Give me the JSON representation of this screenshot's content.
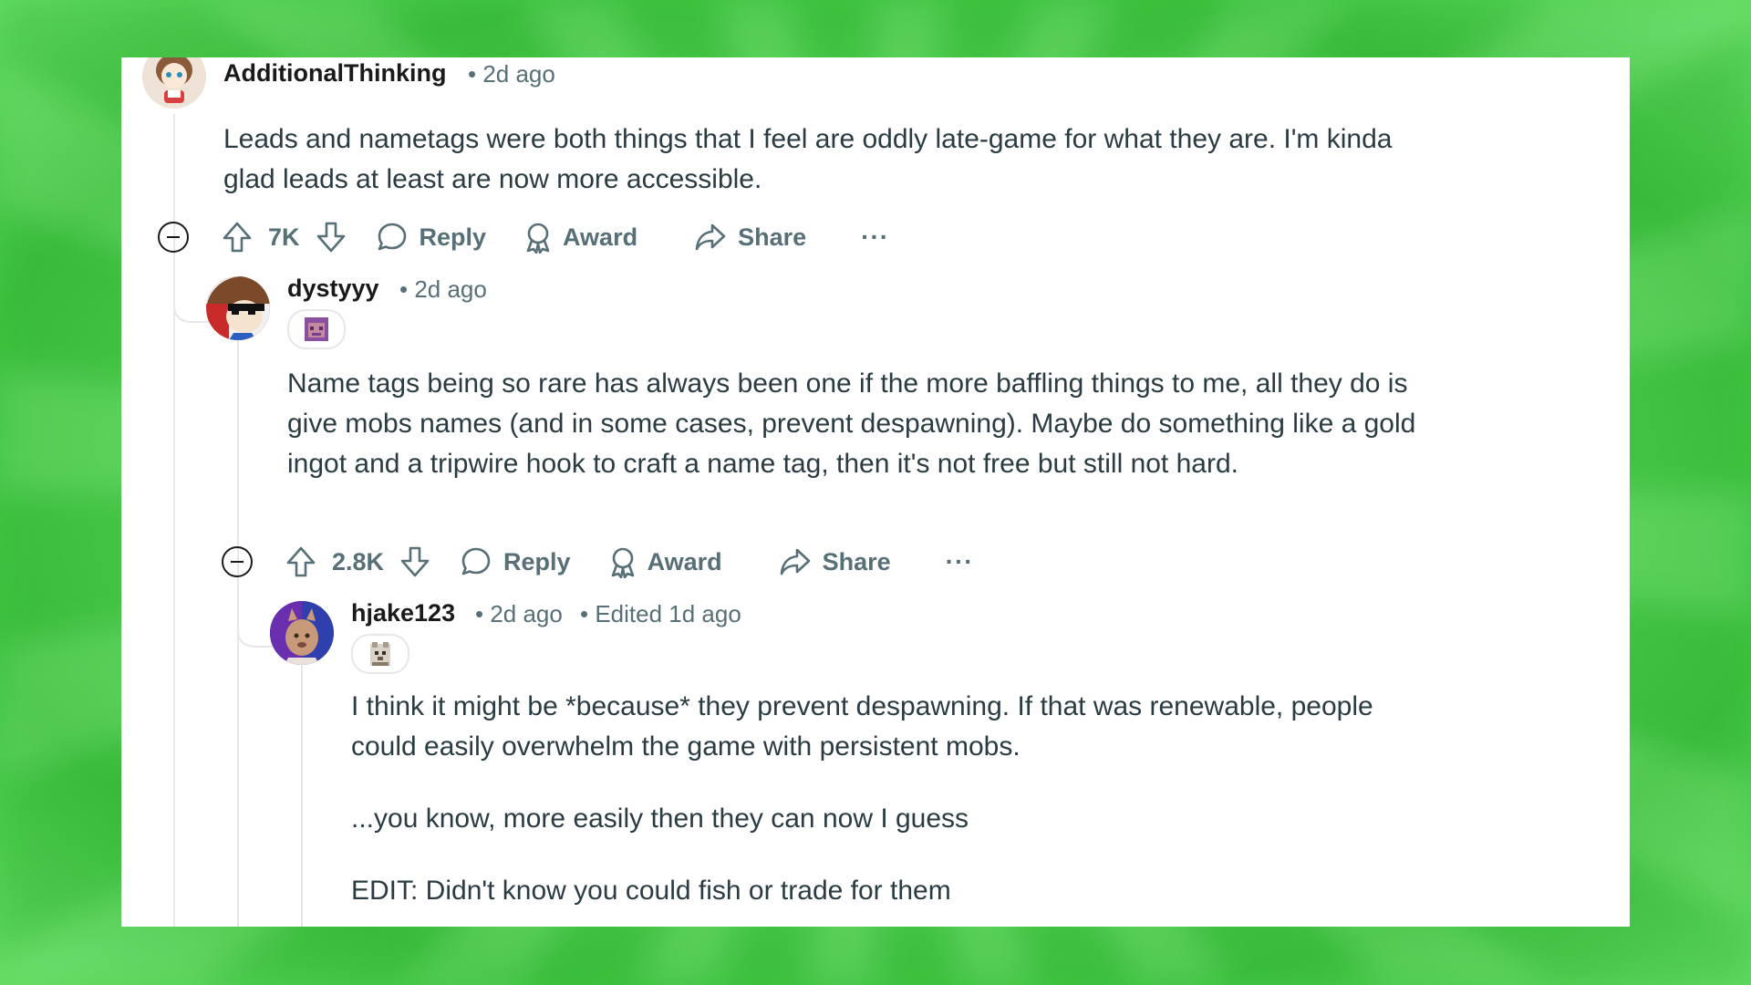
{
  "comments": [
    {
      "username": "AdditionalThinking",
      "time": "• 2d ago",
      "edited": "",
      "body": [
        "Leads and nametags were both things that I feel are oddly late-game for what they are. I'm kinda glad leads at least are now more accessible."
      ],
      "votes": "7K",
      "reply_label": "Reply",
      "award_label": "Award",
      "share_label": "Share",
      "more_label": "···"
    },
    {
      "username": "dystyyy",
      "time": "• 2d ago",
      "edited": "",
      "body": [
        "Name tags being so rare has always been one if the more baffling things to me, all they do is give mobs names (and in some cases, prevent despawning). Maybe do something like a gold ingot and a tripwire hook to craft a name tag, then it's not free but still not hard."
      ],
      "votes": "2.8K",
      "reply_label": "Reply",
      "award_label": "Award",
      "share_label": "Share",
      "more_label": "···"
    },
    {
      "username": "hjake123",
      "time": "• 2d ago",
      "edited": "• Edited 1d ago",
      "body": [
        "I think it might be *because* they prevent despawning. If that was renewable, people could easily overwhelm the game with persistent mobs.",
        "...you know, more easily then they can now I guess",
        "EDIT: Didn't know you could fish or trade for them"
      ]
    }
  ],
  "icons": [
    "collapse-icon",
    "upvote-icon",
    "downvote-icon",
    "comment-icon",
    "award-icon",
    "share-icon",
    "more-icon"
  ],
  "colors": {
    "background": "#55d855",
    "card": "#ffffff",
    "text": "#1a1a1b",
    "muted": "#576f76",
    "thread": "#e5e7ea"
  }
}
